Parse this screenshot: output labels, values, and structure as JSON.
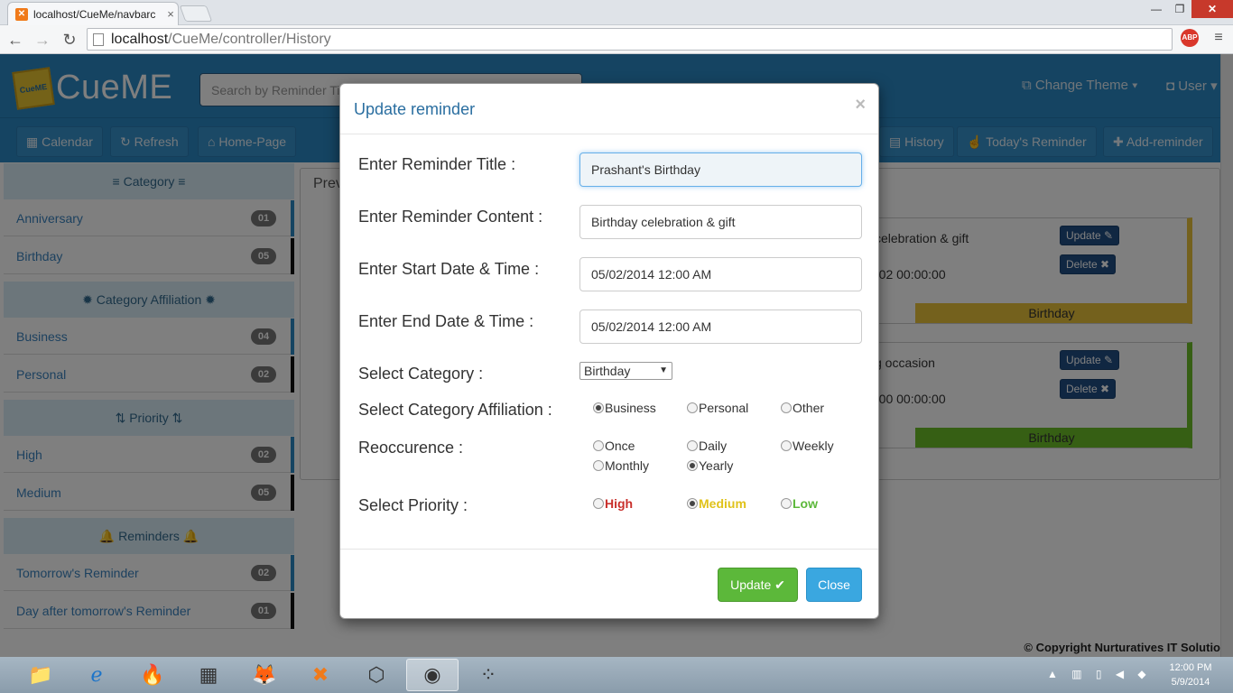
{
  "browser": {
    "tab_title": "localhost/CueMe/navbarc",
    "url_host": "localhost",
    "url_path": "/CueMe/controller/History",
    "abp_label": "ABP"
  },
  "app": {
    "brand": "CueME",
    "logo_text": "CueME",
    "search_placeholder": "Search by Reminder Ti",
    "change_theme": "Change Theme",
    "user": "User"
  },
  "subnav": {
    "calendar": "Calendar",
    "refresh": "Refresh",
    "home": "Home-Page",
    "history": "History",
    "todays": "Today's Reminder",
    "add": "Add-reminder"
  },
  "sidebar": {
    "category_head": "Category",
    "affiliation_head": "Category Affiliation",
    "priority_head": "Priority",
    "reminders_head": "Reminders",
    "items": [
      {
        "label": "Anniversary",
        "count": "01"
      },
      {
        "label": "Birthday",
        "count": "05"
      },
      {
        "label": "Business",
        "count": "04"
      },
      {
        "label": "Personal",
        "count": "02"
      },
      {
        "label": "High",
        "count": "02"
      },
      {
        "label": "Medium",
        "count": "05"
      },
      {
        "label": "Tomorrow's Reminder",
        "count": "02"
      },
      {
        "label": "Day after tomorrow's Reminder",
        "count": "01"
      }
    ]
  },
  "main": {
    "panel_title": "Prev",
    "cards": [
      {
        "content": "celebration & gift",
        "date": "-02 00:00:00",
        "category": "Birthday",
        "update": "Update",
        "delete": "Delete"
      },
      {
        "content": "g occasion",
        "date": "-00 00:00:00",
        "category": "Birthday",
        "update": "Update",
        "delete": "Delete"
      }
    ],
    "copyright": "© Copyright Nurturatives IT Solutio"
  },
  "modal": {
    "title": "Update reminder",
    "close_x": "×",
    "title_label": "Enter Reminder Title :",
    "title_value": "Prashant's Birthday",
    "content_label": "Enter Reminder Content :",
    "content_value": "Birthday celebration & gift",
    "start_label": "Enter Start Date & Time :",
    "start_value": "05/02/2014 12:00 AM",
    "end_label": "Enter End Date & Time :",
    "end_value": "05/02/2014 12:00 AM",
    "category_label": "Select Category :",
    "category_value": "Birthday",
    "affiliation_label": "Select Category Affiliation :",
    "affiliation_options": [
      "Business",
      "Personal",
      "Other"
    ],
    "affiliation_selected": "Business",
    "recurrence_label": "Reoccurence :",
    "recurrence_options": [
      "Once",
      "Daily",
      "Weekly",
      "Monthly",
      "Yearly"
    ],
    "recurrence_selected": "Yearly",
    "priority_label": "Select Priority :",
    "priority_options": [
      "High",
      "Medium",
      "Low"
    ],
    "priority_selected": "Medium",
    "update_button": "Update",
    "close_button": "Close"
  },
  "colors": {
    "primary": "#2a88c4",
    "modal_title": "#2a6ea0",
    "priority_high": "#c9302c",
    "priority_medium": "#e0c21a",
    "priority_low": "#5cb83a",
    "card_yellow": "#e8c33a",
    "card_green": "#6cbf28"
  },
  "taskbar": {
    "time": "12:00 PM",
    "date": "5/9/2014"
  }
}
